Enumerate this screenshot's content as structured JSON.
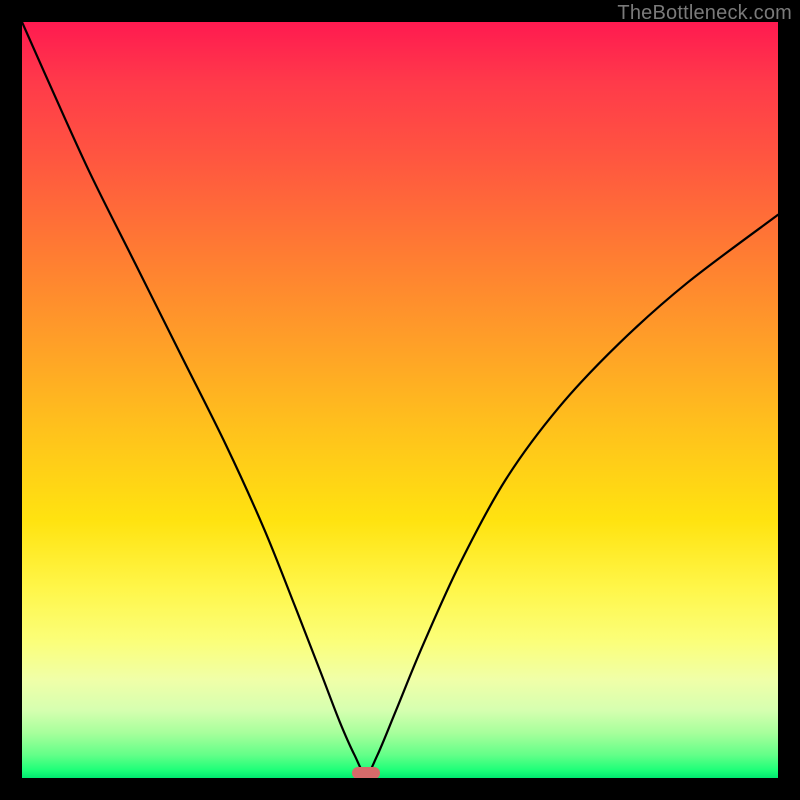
{
  "watermark": "TheBottleneck.com",
  "marker": {
    "x_frac": 0.455,
    "y_frac": 0.993
  },
  "chart_data": {
    "type": "line",
    "title": "",
    "xlabel": "",
    "ylabel": "",
    "xlim": [
      0,
      1
    ],
    "ylim": [
      0,
      1
    ],
    "grid": false,
    "legend": false,
    "annotations": [
      {
        "text": "TheBottleneck.com",
        "position": "top-right"
      }
    ],
    "series": [
      {
        "name": "bottleneck-curve",
        "x": [
          0.0,
          0.04,
          0.09,
          0.15,
          0.21,
          0.27,
          0.32,
          0.36,
          0.395,
          0.42,
          0.44,
          0.455,
          0.47,
          0.495,
          0.53,
          0.58,
          0.64,
          0.71,
          0.79,
          0.88,
          1.0
        ],
        "y": [
          1.0,
          0.91,
          0.8,
          0.68,
          0.56,
          0.44,
          0.33,
          0.23,
          0.14,
          0.075,
          0.03,
          0.005,
          0.03,
          0.09,
          0.175,
          0.285,
          0.395,
          0.49,
          0.575,
          0.655,
          0.745
        ]
      }
    ],
    "marker_point": {
      "x": 0.455,
      "y": 0.005,
      "color": "#d66a6a"
    },
    "background_gradient": {
      "direction": "vertical",
      "stops": [
        {
          "pos": 0.0,
          "color": "#ff1a50"
        },
        {
          "pos": 0.3,
          "color": "#ff7a33"
        },
        {
          "pos": 0.66,
          "color": "#ffe310"
        },
        {
          "pos": 0.9,
          "color": "#d6ffb0"
        },
        {
          "pos": 1.0,
          "color": "#00e870"
        }
      ]
    }
  }
}
